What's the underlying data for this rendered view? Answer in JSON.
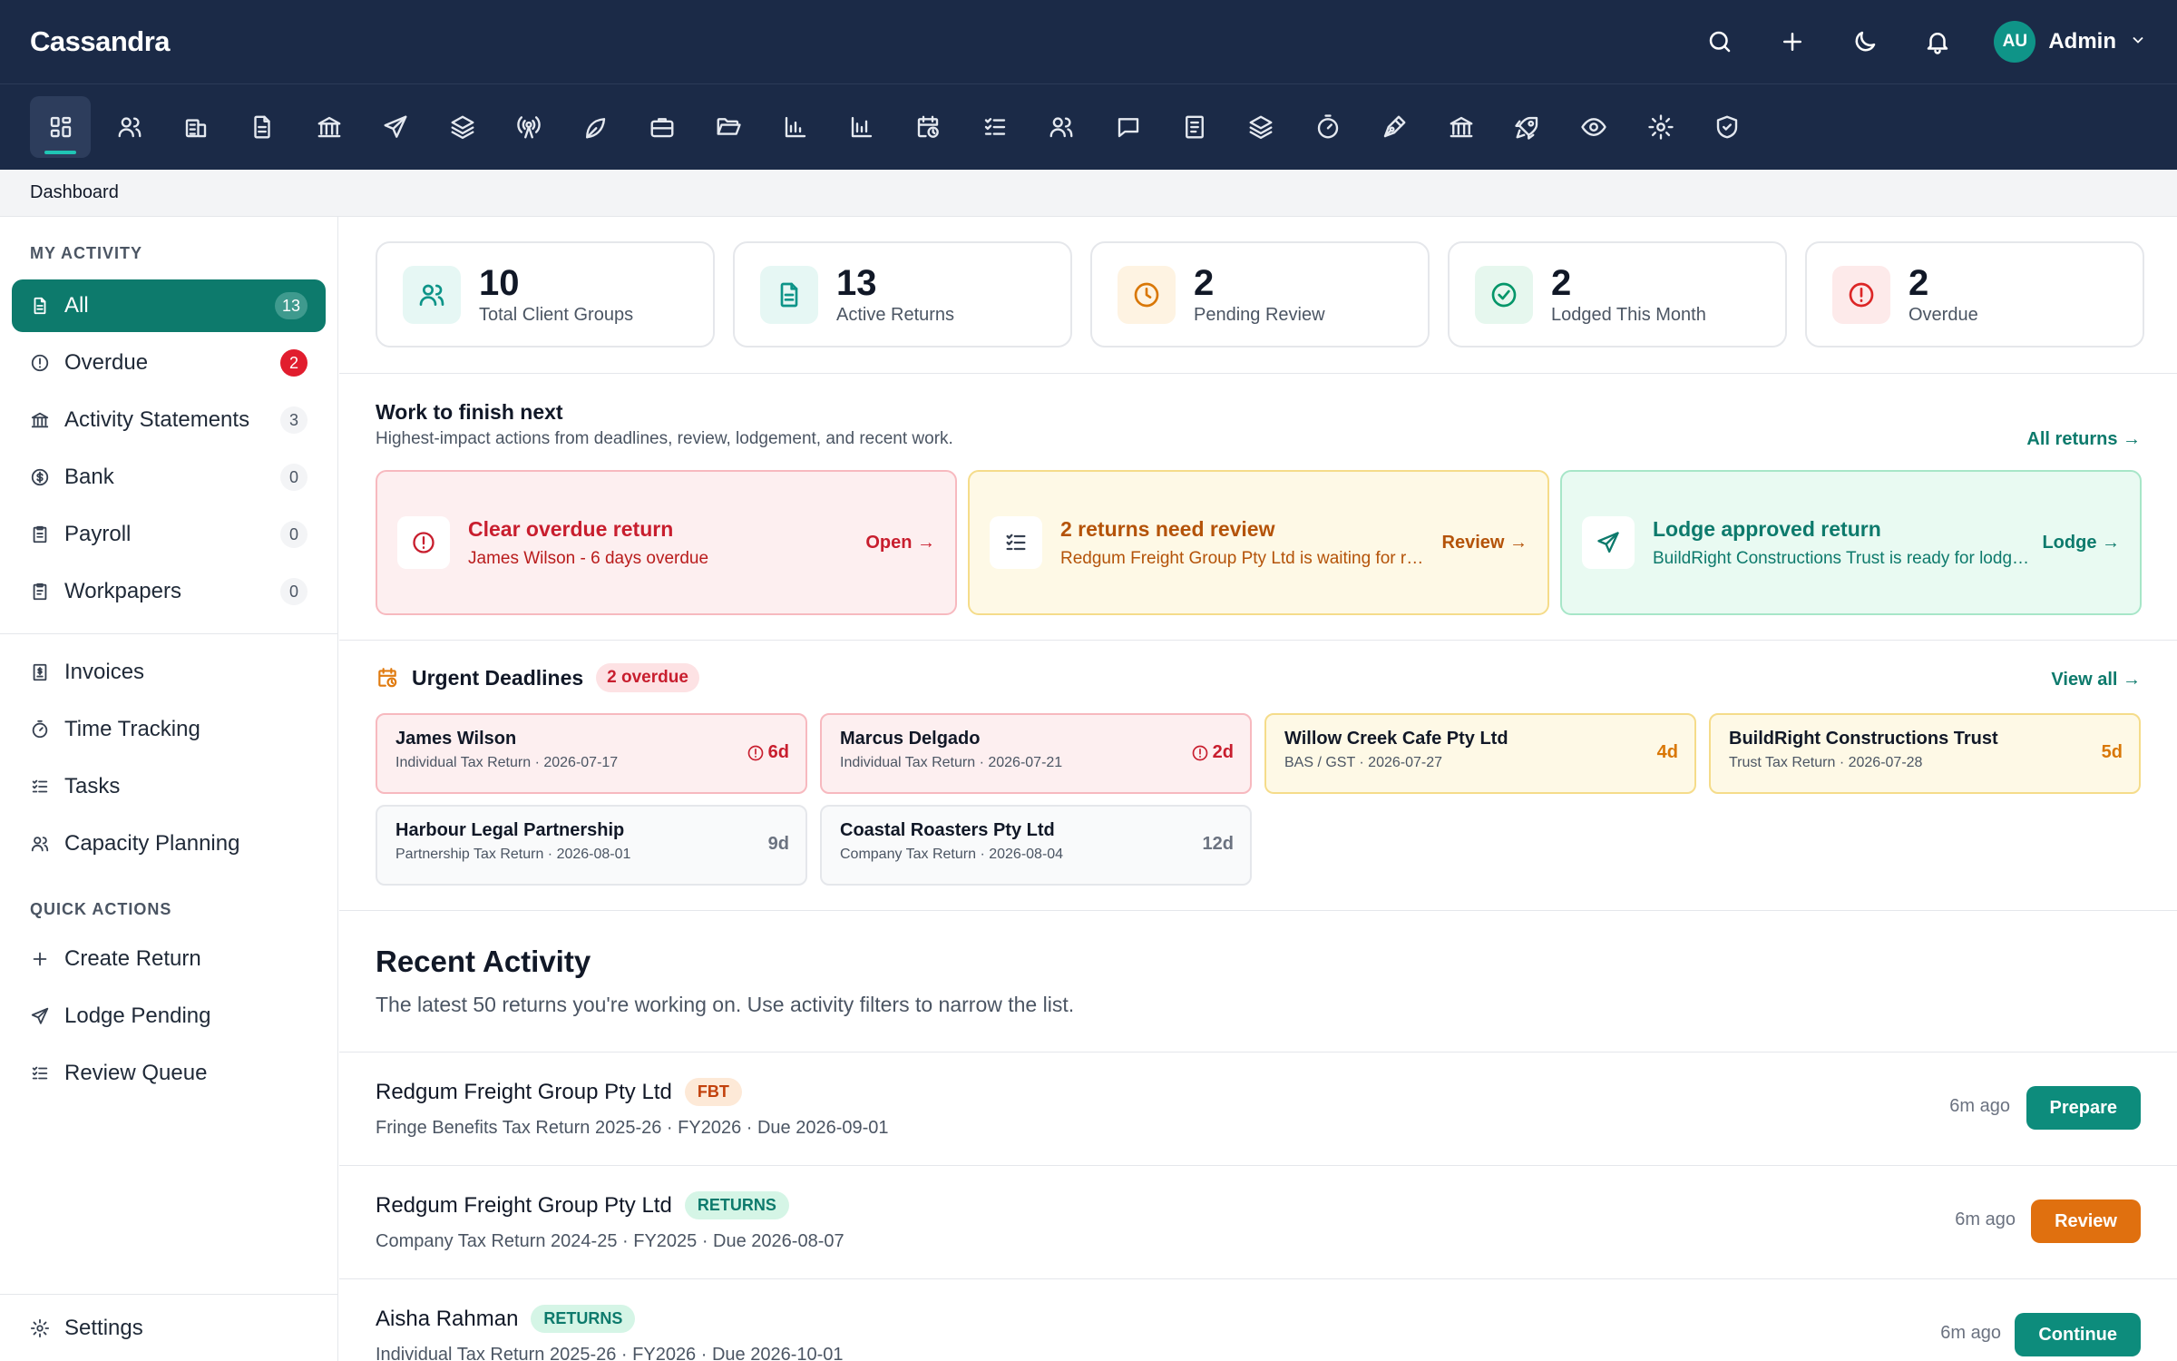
{
  "app": {
    "brand": "Cassandra"
  },
  "topbar": {
    "icons": [
      "search-icon",
      "plus-icon",
      "moon-icon",
      "bell-icon"
    ],
    "user": {
      "initials": "AU",
      "name": "Admin"
    }
  },
  "modules": [
    "dashboard-icon",
    "users-icon",
    "building-icon",
    "document-icon",
    "bank-icon",
    "send-icon",
    "layers-icon",
    "broadcast-icon",
    "leaf-icon",
    "briefcase-icon",
    "folder-icon",
    "bar-chart-icon",
    "bar-chart-icon",
    "calendar-clock-icon",
    "checklist-icon",
    "team-icon",
    "chat-icon",
    "receipt-icon",
    "layers-icon",
    "timer-icon",
    "pen-icon",
    "bank-icon",
    "rocket-icon",
    "eye-icon",
    "gear-icon",
    "shield-check-icon"
  ],
  "breadcrumb": "Dashboard",
  "sidebar": {
    "my_activity_heading": "MY ACTIVITY",
    "activity": [
      {
        "label": "All",
        "count": "13"
      },
      {
        "label": "Overdue",
        "count": "2"
      },
      {
        "label": "Activity Statements",
        "count": "3"
      },
      {
        "label": "Bank",
        "count": "0"
      },
      {
        "label": "Payroll",
        "count": "0"
      },
      {
        "label": "Workpapers",
        "count": "0"
      }
    ],
    "links": [
      {
        "label": "Invoices"
      },
      {
        "label": "Time Tracking"
      },
      {
        "label": "Tasks"
      },
      {
        "label": "Capacity Planning"
      }
    ],
    "quick_actions_heading": "QUICK ACTIONS",
    "quick_actions": [
      {
        "label": "Create Return"
      },
      {
        "label": "Lodge Pending"
      },
      {
        "label": "Review Queue"
      }
    ],
    "settings": "Settings"
  },
  "stats": [
    {
      "value": "10",
      "label": "Total Client Groups",
      "color": "#0d9488"
    },
    {
      "value": "13",
      "label": "Active Returns",
      "color": "#0d9488"
    },
    {
      "value": "2",
      "label": "Pending Review",
      "color": "#d97706"
    },
    {
      "value": "2",
      "label": "Lodged This Month",
      "color": "#059669"
    },
    {
      "value": "2",
      "label": "Overdue",
      "color": "#dc2626"
    }
  ],
  "work_next": {
    "title": "Work to finish next",
    "subtitle": "Highest-impact actions from deadlines, review, lodgement, and recent work.",
    "link": "All returns →",
    "cards": [
      {
        "title": "Clear overdue return",
        "subtitle": "James Wilson - 6 days overdue",
        "action": "Open →"
      },
      {
        "title": "2 returns need review",
        "subtitle": "Redgum Freight Group Pty Ltd is waiting for review",
        "action": "Review →"
      },
      {
        "title": "Lodge approved return",
        "subtitle": "BuildRight Constructions Trust is ready for lodgement",
        "action": "Lodge →"
      }
    ]
  },
  "deadlines": {
    "title": "Urgent Deadlines",
    "badge": "2 overdue",
    "link": "View all →",
    "items": [
      {
        "name": "James Wilson",
        "meta": "Individual Tax Return · 2026-07-17",
        "days": "6d"
      },
      {
        "name": "Marcus Delgado",
        "meta": "Individual Tax Return · 2026-07-21",
        "days": "2d"
      },
      {
        "name": "Willow Creek Cafe Pty Ltd",
        "meta": "BAS / GST · 2026-07-27",
        "days": "4d"
      },
      {
        "name": "BuildRight Constructions Trust",
        "meta": "Trust Tax Return · 2026-07-28",
        "days": "5d"
      },
      {
        "name": "Harbour Legal Partnership",
        "meta": "Partnership Tax Return · 2026-08-01",
        "days": "9d"
      },
      {
        "name": "Coastal Roasters Pty Ltd",
        "meta": "Company Tax Return · 2026-08-04",
        "days": "12d"
      }
    ]
  },
  "recent": {
    "title": "Recent Activity",
    "subtitle": "The latest 50 returns you're working on. Use activity filters to narrow the list.",
    "rows": [
      {
        "name": "Redgum Freight Group Pty Ltd",
        "tag": "FBT",
        "meta": "Fringe Benefits Tax Return 2025-26 · FY2026 · Due 2026-09-01",
        "time": "6m ago",
        "action": "Prepare",
        "action_color": "#0d8c7c"
      },
      {
        "name": "Redgum Freight Group Pty Ltd",
        "tag": "RETURNS",
        "meta": "Company Tax Return 2024-25 · FY2025 · Due 2026-08-07",
        "time": "6m ago",
        "action": "Review",
        "action_color": "#e0700f"
      },
      {
        "name": "Aisha Rahman",
        "tag": "RETURNS",
        "meta": "Individual Tax Return 2025-26 · FY2026 · Due 2026-10-01",
        "time": "6m ago",
        "action": "Continue",
        "action_color": "#0d8c7c"
      }
    ]
  }
}
